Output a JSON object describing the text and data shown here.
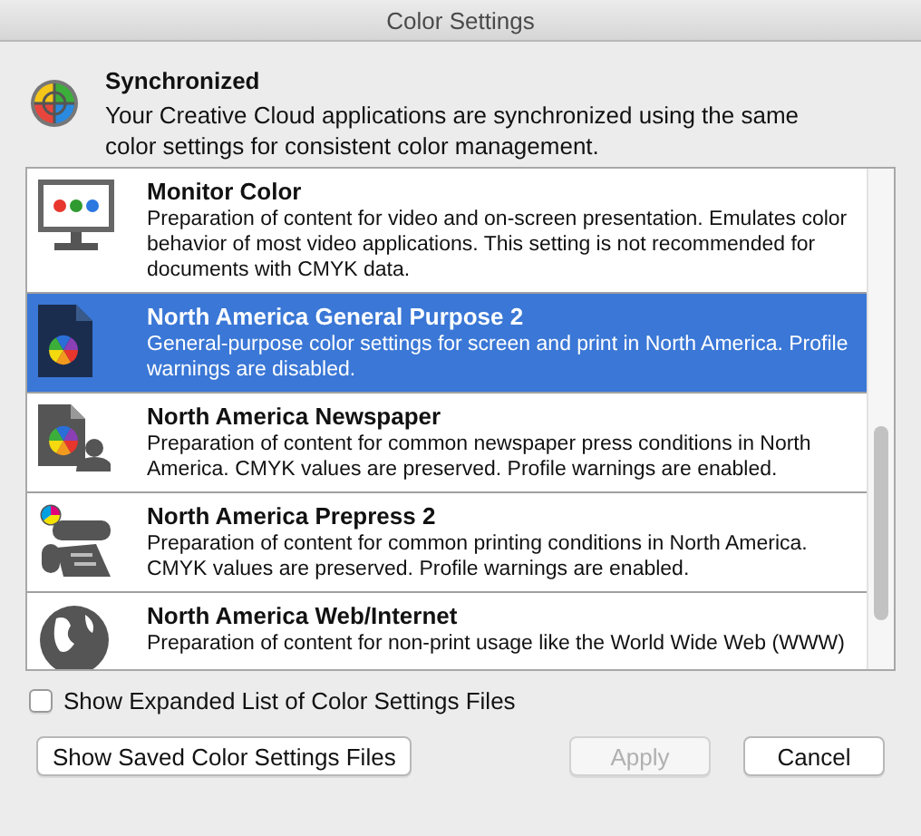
{
  "window": {
    "title": "Color Settings"
  },
  "sync": {
    "title": "Synchronized",
    "message": "Your Creative Cloud applications are synchronized using the same color settings for consistent color management."
  },
  "settings": [
    {
      "kind": "monitor",
      "name": "Monitor Color",
      "description": "Preparation of content for video and on-screen presentation. Emulates color behavior of most video applications. This setting is not recommended for documents with CMYK data.",
      "selected": false
    },
    {
      "kind": "document",
      "name": "North America General Purpose 2",
      "description": "General-purpose color settings for screen and print in North America. Profile warnings are disabled.",
      "selected": true
    },
    {
      "kind": "newspaper",
      "name": "North America Newspaper",
      "description": "Preparation of content for common newspaper press conditions in North America. CMYK values are preserved. Profile warnings are enabled.",
      "selected": false
    },
    {
      "kind": "prepress",
      "name": "North America Prepress 2",
      "description": "Preparation of content for common printing conditions in North America. CMYK values are preserved. Profile warnings are enabled.",
      "selected": false
    },
    {
      "kind": "web",
      "name": "North America Web/Internet",
      "description": "Preparation of content for non-print usage like the World Wide Web (WWW)",
      "selected": false
    }
  ],
  "expanded_list": {
    "label": "Show Expanded List of Color Settings Files",
    "checked": false
  },
  "buttons": [
    {
      "label": "Show Saved Color Settings Files",
      "disabled": false
    },
    {
      "label": "Apply",
      "disabled": true
    },
    {
      "label": "Cancel",
      "disabled": false
    }
  ]
}
